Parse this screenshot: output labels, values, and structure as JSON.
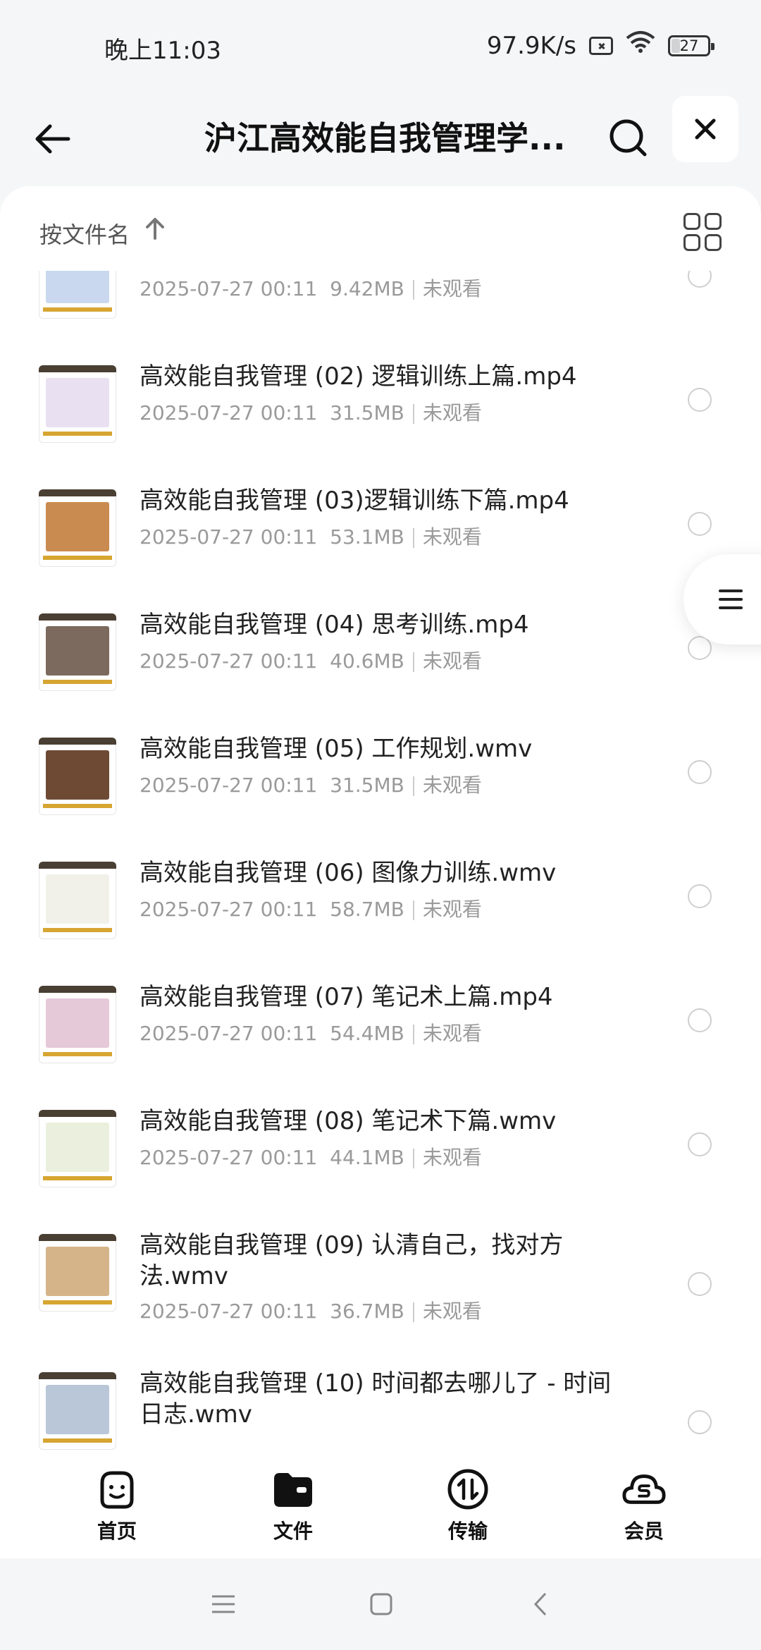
{
  "status_bar": {
    "time": "晚上11:03",
    "net_speed": "97.9K/s",
    "battery": "27"
  },
  "header": {
    "title": "沪江高效能自我管理学..."
  },
  "sort": {
    "label": "按文件名"
  },
  "files": [
    {
      "name": "",
      "date": "2025-07-27 00:11",
      "size": "9.42MB",
      "status": "未观看",
      "thumb_color": "#c9d8ef"
    },
    {
      "name": "高效能自我管理 (02) 逻辑训练上篇.mp4",
      "date": "2025-07-27 00:11",
      "size": "31.5MB",
      "status": "未观看",
      "thumb_color": "#e9e1f2"
    },
    {
      "name": "高效能自我管理 (03)逻辑训练下篇.mp4",
      "date": "2025-07-27 00:11",
      "size": "53.1MB",
      "status": "未观看",
      "thumb_color": "#c98b4f"
    },
    {
      "name": "高效能自我管理 (04) 思考训练.mp4",
      "date": "2025-07-27 00:11",
      "size": "40.6MB",
      "status": "未观看",
      "thumb_color": "#7b6a5d"
    },
    {
      "name": "高效能自我管理 (05)  工作规划.wmv",
      "date": "2025-07-27 00:11",
      "size": "31.5MB",
      "status": "未观看",
      "thumb_color": "#6e4a35"
    },
    {
      "name": "高效能自我管理 (06) 图像力训练.wmv",
      "date": "2025-07-27 00:11",
      "size": "58.7MB",
      "status": "未观看",
      "thumb_color": "#f1f1ea"
    },
    {
      "name": "高效能自我管理 (07)  笔记术上篇.mp4",
      "date": "2025-07-27 00:11",
      "size": "54.4MB",
      "status": "未观看",
      "thumb_color": "#e6c9d9"
    },
    {
      "name": "高效能自我管理 (08) 笔记术下篇.wmv",
      "date": "2025-07-27 00:11",
      "size": "44.1MB",
      "status": "未观看",
      "thumb_color": "#eaf0dd"
    },
    {
      "name": "高效能自我管理 (09) 认清自己，找对方法.wmv",
      "date": "2025-07-27 00:11",
      "size": "36.7MB",
      "status": "未观看",
      "thumb_color": "#d5b48a"
    },
    {
      "name": "高效能自我管理 (10) 时间都去哪儿了 - 时间日志.wmv",
      "date": "",
      "size": "",
      "status": "",
      "thumb_color": "#b9c7d8"
    }
  ],
  "bottom_nav": [
    {
      "label": "首页",
      "icon": "smile-home-icon"
    },
    {
      "label": "文件",
      "icon": "folder-icon"
    },
    {
      "label": "传输",
      "icon": "transfer-icon"
    },
    {
      "label": "会员",
      "icon": "cloud-vip-icon"
    }
  ]
}
